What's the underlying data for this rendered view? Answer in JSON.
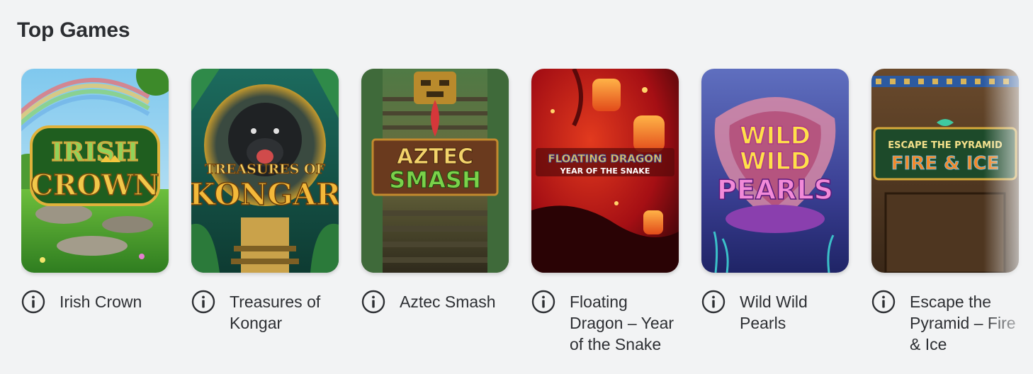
{
  "section": {
    "title": "Top Games"
  },
  "games": [
    {
      "name": "Irish Crown",
      "logo_line1": "IRISH",
      "logo_line2": "CROWN"
    },
    {
      "name": "Treasures of Kongar",
      "logo_line1": "TREASURES OF",
      "logo_line2": "KONGAR"
    },
    {
      "name": "Aztec Smash",
      "logo_line1": "AZTEC",
      "logo_line2": "SMASH"
    },
    {
      "name": "Floating Dragon – Year of the Snake",
      "logo_line1": "FLOATING DRAGON",
      "logo_line2": "YEAR OF THE SNAKE"
    },
    {
      "name": "Wild Wild Pearls",
      "logo_line1": "WILD",
      "logo_line2": "WILD",
      "logo_line3": "PEARLS"
    },
    {
      "name": "Escape the Pyramid – Fire & Ice",
      "logo_line1": "ESCAPE THE PYRAMID",
      "logo_line2": "FIRE & ICE"
    }
  ],
  "icons": {
    "info": "info-circle-icon"
  },
  "colors": {
    "background": "#f2f3f4",
    "text": "#2d2f33"
  }
}
